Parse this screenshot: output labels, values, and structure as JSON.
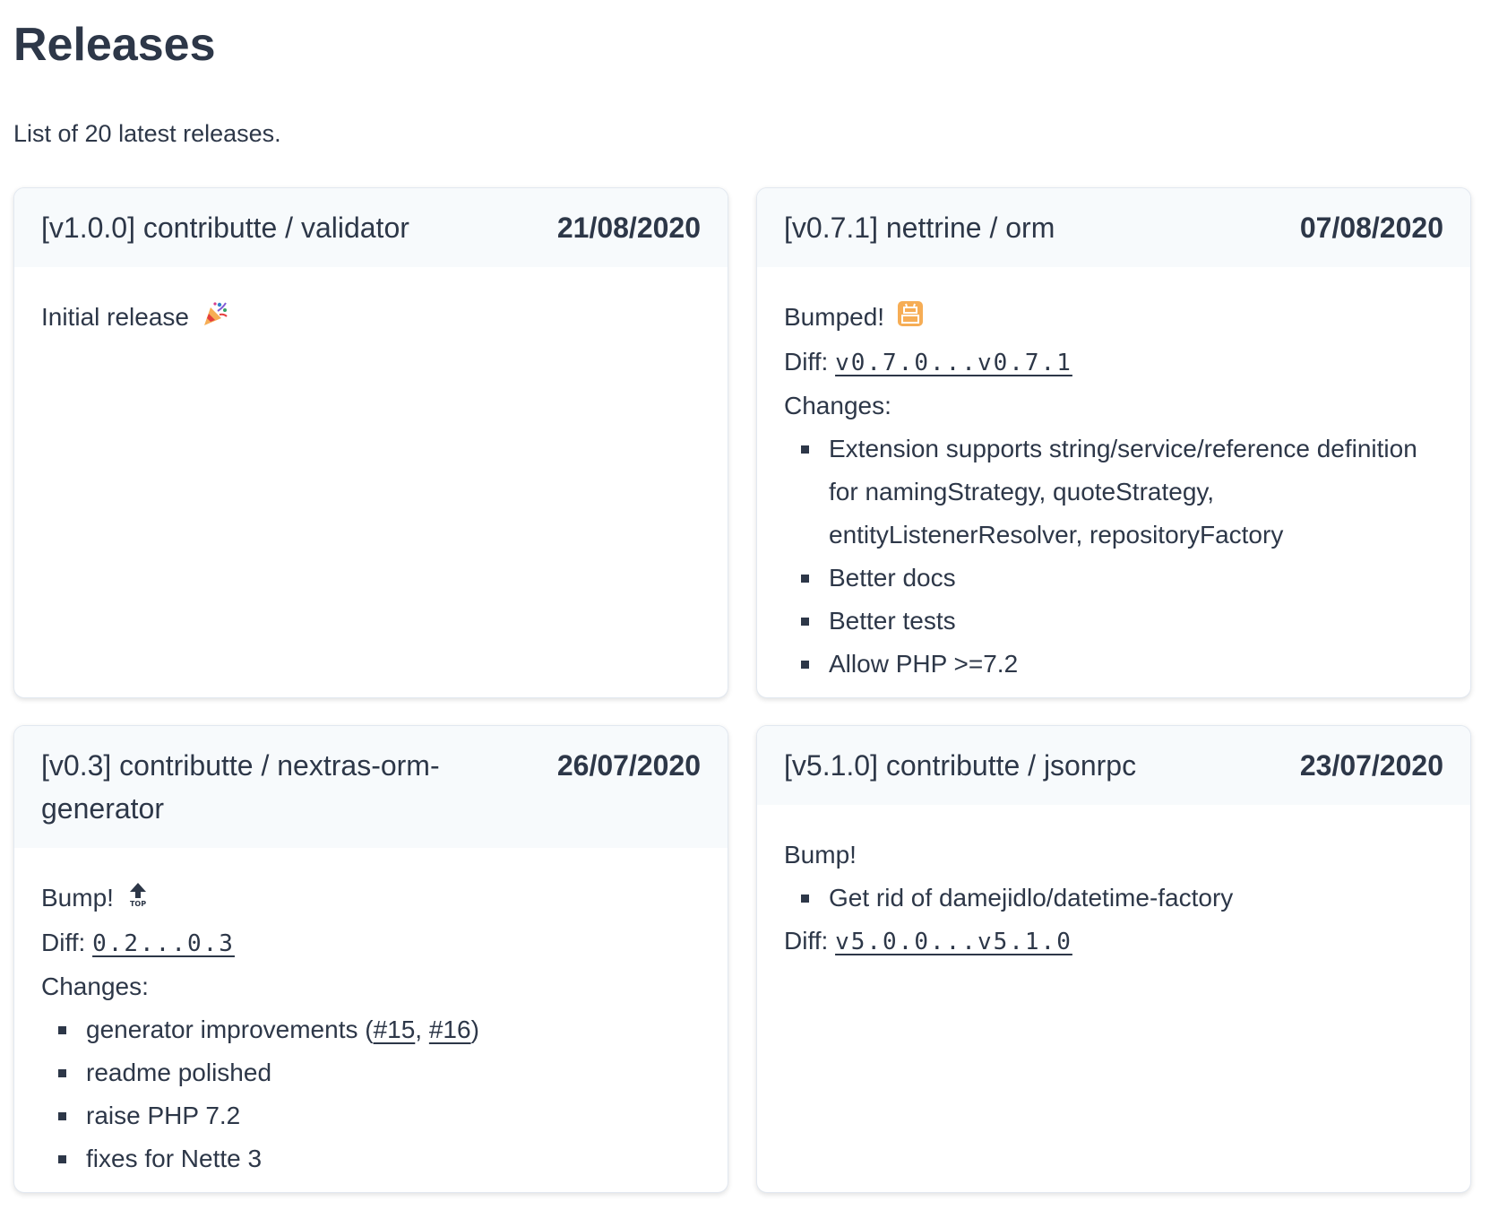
{
  "page": {
    "title": "Releases",
    "subtitle": "List of 20 latest releases."
  },
  "releases": [
    {
      "title": "[v1.0.0] contributte / validator",
      "date": "21/08/2020",
      "intro": "Initial release",
      "intro_icon": "party-popper-icon"
    },
    {
      "title": "[v0.7.1] nettrine / orm",
      "date": "07/08/2020",
      "intro": "Bumped!",
      "intro_icon": "japanese-open-for-business-icon",
      "diff_label": "Diff:",
      "diff": "v0.7.0...v0.7.1",
      "changes_label": "Changes:",
      "changes": [
        "Extension supports string/service/reference definition for namingStrategy, quoteStrategy, entityListenerResolver, repositoryFactory",
        "Better docs",
        "Better tests",
        "Allow PHP >=7.2"
      ]
    },
    {
      "title": "[v0.3] contributte / nextras-orm-generator",
      "date": "26/07/2020",
      "intro": "Bump!",
      "intro_icon": "top-arrow-icon",
      "diff_label": "Diff:",
      "diff": "0.2...0.3",
      "changes_label": "Changes:",
      "changes": [
        "generator improvements (",
        "readme polished",
        "raise PHP 7.2",
        "fixes for Nette 3"
      ],
      "issue_links": [
        "#15",
        "#16"
      ],
      "issue_sep": ", ",
      "issue_close": ")"
    },
    {
      "title": "[v5.1.0] contributte / jsonrpc",
      "date": "23/07/2020",
      "intro": "Bump!",
      "changes": [
        "Get rid of damejidlo/datetime-factory"
      ],
      "diff_label": "Diff:",
      "diff": "v5.0.0...v5.1.0"
    }
  ],
  "colors": {
    "text": "#2d3748",
    "header_bg": "#f7fafc",
    "border": "#e2e8f0",
    "emoji_orange": "#f6ad55"
  }
}
